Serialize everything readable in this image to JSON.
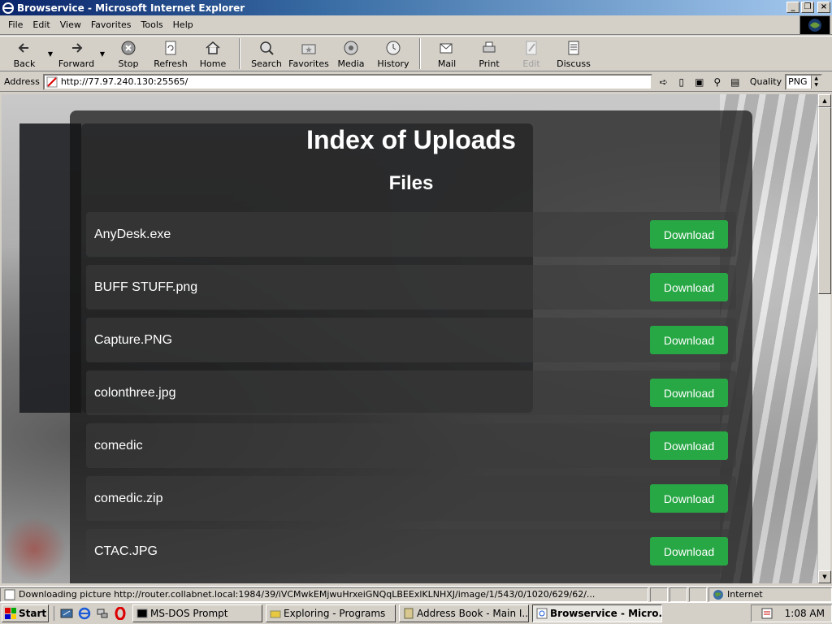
{
  "window": {
    "title": "Browservice - Microsoft Internet Explorer",
    "buttons": [
      "_",
      "❐",
      "×"
    ]
  },
  "menu": [
    "File",
    "Edit",
    "View",
    "Favorites",
    "Tools",
    "Help"
  ],
  "toolbar": {
    "back": "Back",
    "forward": "Forward",
    "stop": "Stop",
    "refresh": "Refresh",
    "home": "Home",
    "search": "Search",
    "favorites": "Favorites",
    "media": "Media",
    "history": "History",
    "mail": "Mail",
    "print": "Print",
    "edit": "Edit",
    "discuss": "Discuss"
  },
  "address": {
    "label": "Address",
    "url": "http://77.97.240.130:25565/",
    "quality_label": "Quality",
    "quality_value": "PNG"
  },
  "page": {
    "title": "Index of Uploads",
    "section": "Files",
    "download_label": "Download",
    "files": [
      "AnyDesk.exe",
      "BUFF STUFF.png",
      "Capture.PNG",
      "colonthree.jpg",
      "comedic",
      "comedic.zip",
      "CTAC.JPG"
    ]
  },
  "status": {
    "text": "Downloading picture http://router.collabnet.local:1984/39/iVCMwkEMjwuHrxeiGNQqLBEExlKLNHXJ/image/1/543/0/1020/629/62/...",
    "zone": "Internet"
  },
  "taskbar": {
    "start": "Start",
    "tasks": [
      "MS-DOS Prompt",
      "Exploring - Programs",
      "Address Book - Main I...",
      "Browservice - Micro..."
    ],
    "clock": "1:08 AM"
  },
  "colors": {
    "titlebar": "#0a246a",
    "download_button": "#28a745",
    "chrome": "#d4d0c8"
  }
}
